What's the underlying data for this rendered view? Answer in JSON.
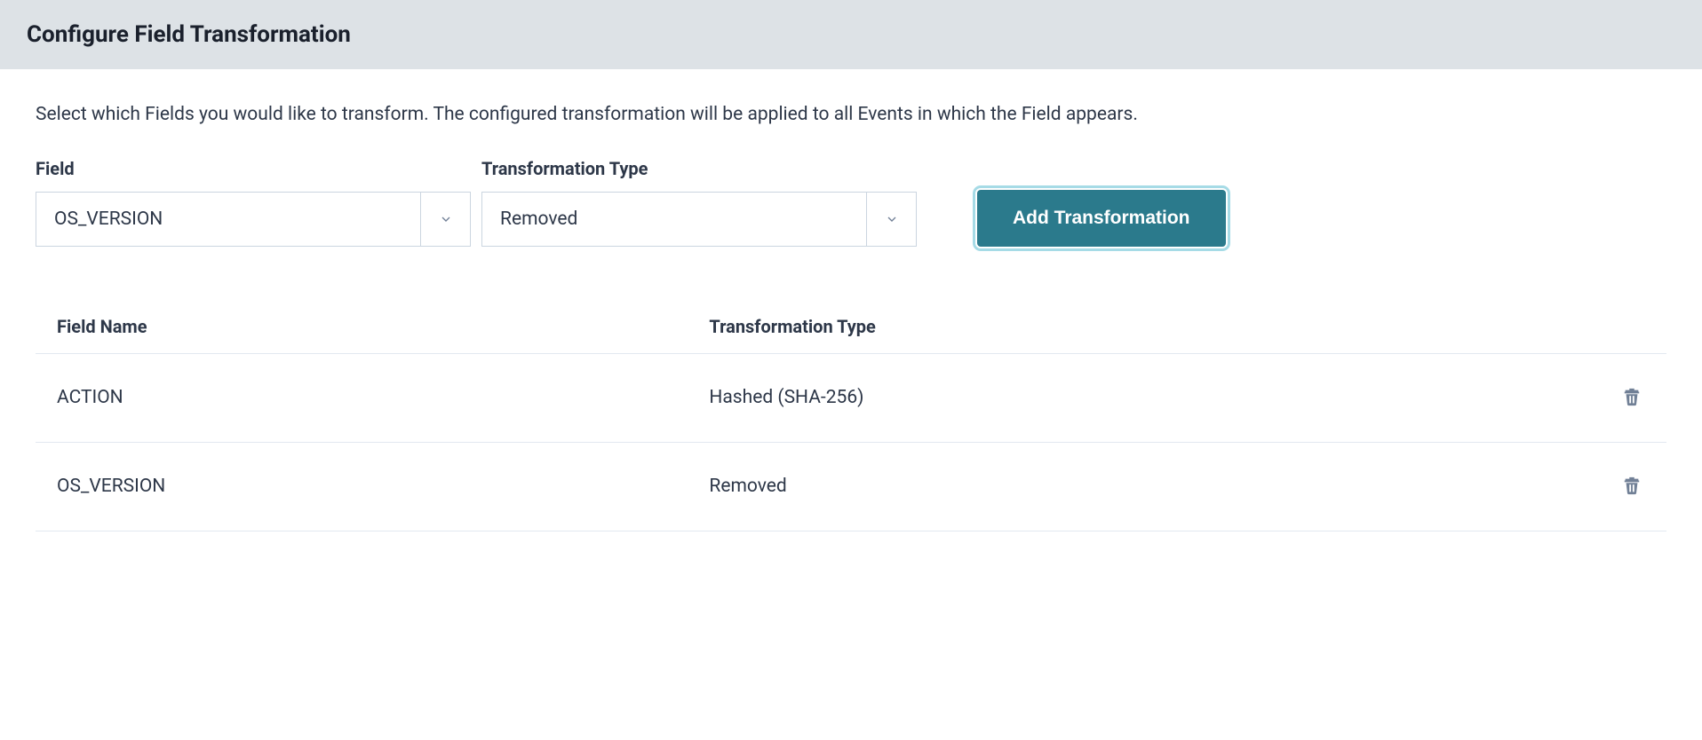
{
  "header": {
    "title": "Configure Field Transformation"
  },
  "main": {
    "description": "Select which Fields you would like to transform. The configured transformation will be applied to all Events in which the Field appears.",
    "form": {
      "field_label": "Field",
      "field_value": "OS_VERSION",
      "type_label": "Transformation Type",
      "type_value": "Removed",
      "add_button_label": "Add Transformation"
    },
    "table": {
      "headers": {
        "field_name": "Field Name",
        "transformation_type": "Transformation Type"
      },
      "rows": [
        {
          "field_name": "ACTION",
          "transformation_type": "Hashed (SHA-256)"
        },
        {
          "field_name": "OS_VERSION",
          "transformation_type": "Removed"
        }
      ]
    }
  }
}
